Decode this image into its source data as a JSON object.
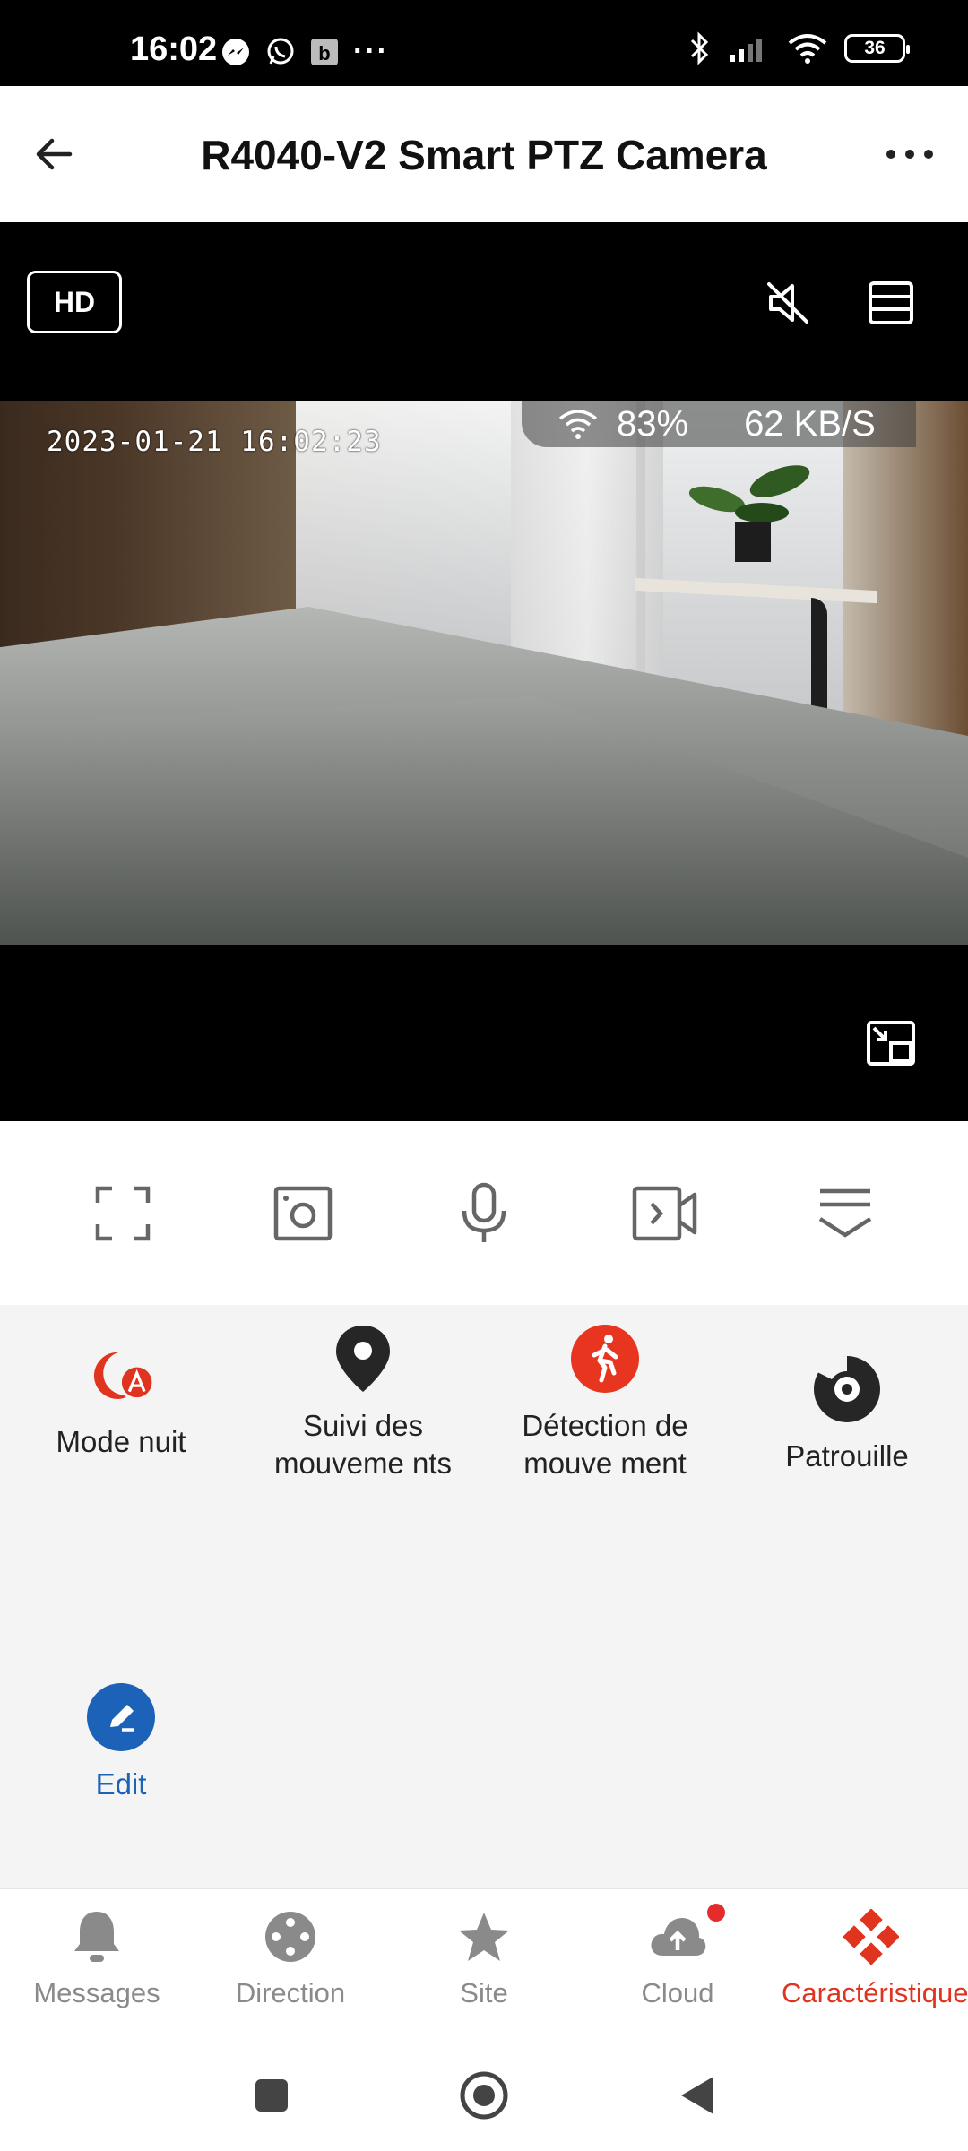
{
  "status_bar": {
    "time": "16:02",
    "left_icons": [
      "messenger-icon",
      "whatsapp-icon",
      "b-icon",
      "more-dots-icon"
    ],
    "b_glyph": "b",
    "dots": "···",
    "battery": "36"
  },
  "header": {
    "title": "R4040-V2 Smart PTZ Camera"
  },
  "video": {
    "quality": "HD",
    "timestamp": "2023-01-21 16:02:23",
    "signal": "83%",
    "bitrate": "62 KB/S"
  },
  "toolbar": [
    "fullscreen-icon",
    "snapshot-icon",
    "microphone-icon",
    "record-icon",
    "expand-panel-icon"
  ],
  "features": [
    {
      "label": "Mode nuit"
    },
    {
      "label": "Suivi des mouveme nts"
    },
    {
      "label": "Détection de mouve ment"
    },
    {
      "label": "Patrouille"
    }
  ],
  "edit_label": "Edit",
  "bottom_nav": [
    {
      "label": "Messages"
    },
    {
      "label": "Direction"
    },
    {
      "label": "Site"
    },
    {
      "label": "Cloud"
    },
    {
      "label": "Caractéristiques"
    }
  ],
  "colors": {
    "accent": "#e0341f",
    "edit_blue": "#1c62b9",
    "panel_bg": "#f4f4f4"
  }
}
